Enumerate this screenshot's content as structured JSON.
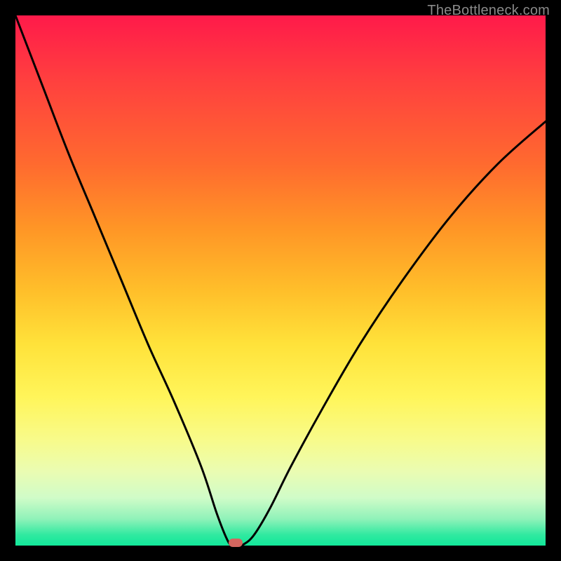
{
  "watermark": "TheBottleneck.com",
  "colors": {
    "background": "#000000",
    "curve": "#000000",
    "marker": "#d3665f"
  },
  "chart_data": {
    "type": "line",
    "title": "",
    "xlabel": "",
    "ylabel": "",
    "xlim": [
      0,
      100
    ],
    "ylim": [
      0,
      100
    ],
    "grid": false,
    "legend": false,
    "series": [
      {
        "name": "bottleneck-curve",
        "x": [
          0,
          5,
          10,
          15,
          20,
          25,
          30,
          35,
          38,
          40,
          41,
          42,
          43,
          45,
          48,
          52,
          58,
          65,
          73,
          82,
          91,
          100
        ],
        "values": [
          100,
          87,
          74,
          62,
          50,
          38,
          27,
          15,
          6,
          1,
          0,
          0,
          0.2,
          2,
          7,
          15,
          26,
          38,
          50,
          62,
          72,
          80
        ]
      }
    ],
    "marker": {
      "x": 41.5,
      "y": 0
    },
    "gradient_stops": [
      {
        "pos": 0,
        "color": "#ff1a4a"
      },
      {
        "pos": 50,
        "color": "#ffbf2a"
      },
      {
        "pos": 80,
        "color": "#f8fb8a"
      },
      {
        "pos": 100,
        "color": "#12e89a"
      }
    ]
  }
}
